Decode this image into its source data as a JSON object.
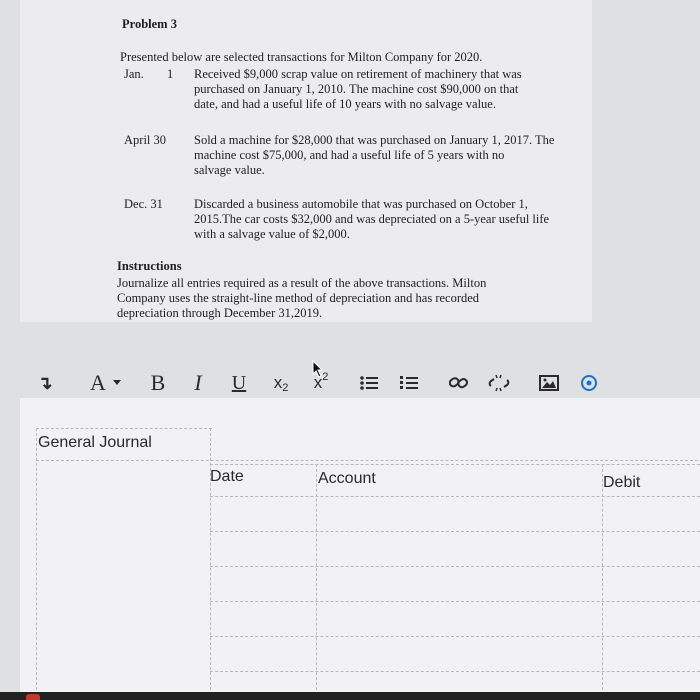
{
  "problem": {
    "title": "Problem 3",
    "intro": "Presented below are selected transactions for Milton Company for 2020.",
    "transactions": [
      {
        "date_month": "Jan.",
        "date_day": "1",
        "lines": [
          "Received $9,000 scrap value on retirement of machinery that was",
          "purchased on January 1, 2010. The machine cost $90,000 on that",
          "date, and had a useful life of 10 years with no salvage value."
        ]
      },
      {
        "date": "April 30",
        "lines": [
          "Sold a machine for $28,000 that was purchased on January 1, 2017. The",
          "machine         cost $75,000, and had a useful life of 5 years with no",
          "salvage value."
        ]
      },
      {
        "date": "Dec. 31",
        "lines": [
          "Discarded a business automobile that was purchased on October 1,",
          "2015.The car costs $32,000 and was depreciated on a 5-year useful life",
          "with a salvage value of $2,000."
        ]
      }
    ],
    "instructions_heading": "Instructions",
    "instructions_lines": [
      "Journalize all entries required as a result of the above transactions. Milton",
      "Company uses the straight-line method of depreciation and has recorded",
      "depreciation through December 31,2019."
    ]
  },
  "toolbar": {
    "paragraph_icon": "↴",
    "font_color": "A",
    "bold": "B",
    "italic": "I",
    "underline": "U",
    "subscript": "x",
    "subscript_mark": "2",
    "superscript": "x",
    "superscript_mark": "2",
    "icons": [
      "paragraph-icon",
      "font-color-icon",
      "bold-icon",
      "italic-icon",
      "underline-icon",
      "subscript-icon",
      "superscript-icon",
      "bullet-list-icon",
      "numbered-list-icon",
      "link-icon",
      "unlink-icon",
      "image-icon",
      "more-icon"
    ],
    "accent_color": "#1a73c9"
  },
  "journal": {
    "title": "General Journal",
    "columns": [
      "Date",
      "Account",
      "Debit"
    ],
    "rows": 5
  }
}
